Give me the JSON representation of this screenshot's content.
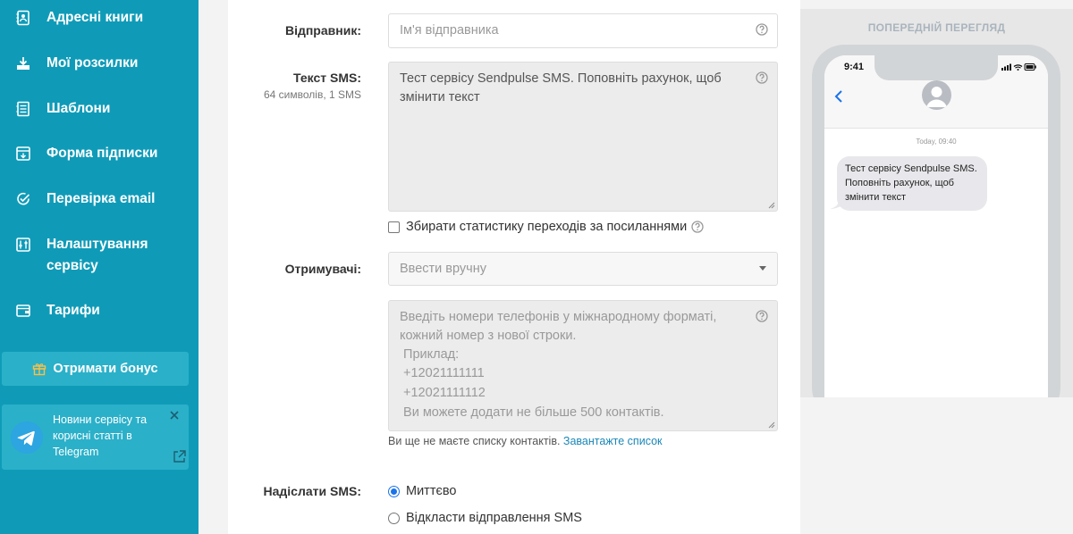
{
  "sidebar": {
    "items": [
      {
        "label": "Адресні книги",
        "icon": "address-book-icon"
      },
      {
        "label": "Мої розсилки",
        "icon": "campaigns-icon"
      },
      {
        "label": "Шаблони",
        "icon": "templates-icon"
      },
      {
        "label": "Форма підписки",
        "icon": "subscription-form-icon"
      },
      {
        "label": "Перевірка email",
        "icon": "email-check-icon"
      },
      {
        "label": "Налаштування сервісу",
        "icon": "settings-sliders-icon"
      },
      {
        "label": "Тарифи",
        "icon": "wallet-icon"
      }
    ],
    "bonus_label": "Отримати бонус",
    "telegram_text": "Новини сервісу та корисні статті в Telegram"
  },
  "form": {
    "sender_label": "Відправник:",
    "sender_placeholder": "Ім'я відправника",
    "sms_text_label": "Текст SMS:",
    "sms_counter": "64 символів, 1 SMS",
    "sms_text_value": "Тест сервісу Sendpulse SMS. Поповніть рахунок, щоб змінити текст",
    "track_links_label": "Збирати статистику переходів за посиланнями",
    "recipients_label": "Отримувачі:",
    "recipients_select_value": "Ввести вручну",
    "phones_placeholder_lines": [
      "Введіть номери телефонів у міжнародному форматі,",
      "кожний номер з нової строки.",
      " Приклад:",
      " +12021111111",
      " +12021111112",
      " Ви можете додати не більше 500 контактів."
    ],
    "no_list_text": "Ви ще не маєте списку контактів.",
    "upload_link": "Завантажте список",
    "send_label": "Надіслати SMS:",
    "send_now_label": "Миттєво",
    "send_later_label": "Відкласти відправлення SMS"
  },
  "preview": {
    "title": "ПОПЕРЕДНІЙ ПЕРЕГЛЯД",
    "phone_time": "9:41",
    "message_time": "Today, 09:40",
    "message_text": "Тест сервісу Sendpulse SMS. Поповніть рахунок, щоб змінити текст"
  },
  "colors": {
    "sidebar_bg": "#0f9bb8",
    "sidebar_button_bg": "#2bb0c9",
    "link": "#1a87b8",
    "ios_blue": "#1a73e8"
  }
}
